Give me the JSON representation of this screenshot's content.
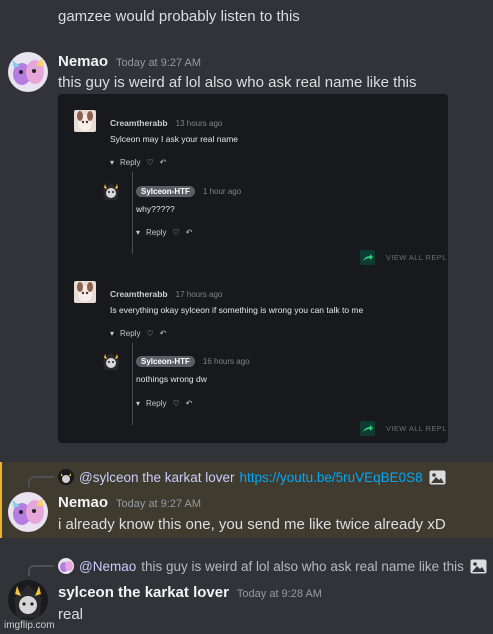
{
  "chat": {
    "top_line": "gamzee would probably listen to this",
    "messages": [
      {
        "username": "Nemao",
        "time": "Today at 9:27 AM",
        "text": "this guy is weird af lol also who ask real name like this"
      },
      {
        "reply_name": "@sylceon the karkat lover",
        "reply_link": "https://youtu.be/5ruVEqBE0S8",
        "username": "Nemao",
        "time": "Today at 9:27 AM",
        "text": "i already know this one, you send me like twice already xD"
      },
      {
        "reply_name": "@Nemao",
        "reply_text": "this guy is weird af lol also who ask real name like this",
        "username": "sylceon the karkat lover",
        "time": "Today at 9:28 AM",
        "text": "real"
      }
    ]
  },
  "embed": {
    "threads": [
      {
        "author": "Creamtherabb",
        "time": "13 hours ago",
        "text": "Sylceon may I ask your real name",
        "reply_label": "Reply",
        "reply": {
          "author": "Sylceon-HTF",
          "time": "1 hour ago",
          "text": "why?????",
          "reply_label": "Reply"
        },
        "view_all": "VIEW ALL REPL"
      },
      {
        "author": "Creamtherabb",
        "time": "17 hours ago",
        "text": "Is everything okay sylceon if something is wrong you can talk to me",
        "reply_label": "Reply",
        "reply": {
          "author": "Sylceon-HTF",
          "time": "16 hours ago",
          "text": "nothings wrong dw",
          "reply_label": "Reply"
        },
        "view_all": "VIEW ALL REPL"
      }
    ]
  },
  "watermark": "imgflip.com",
  "colors": {
    "background": "#313338",
    "mention_highlight": "#3f3b2f",
    "mention_bar": "#f0b232",
    "link": "#00a8fc"
  }
}
